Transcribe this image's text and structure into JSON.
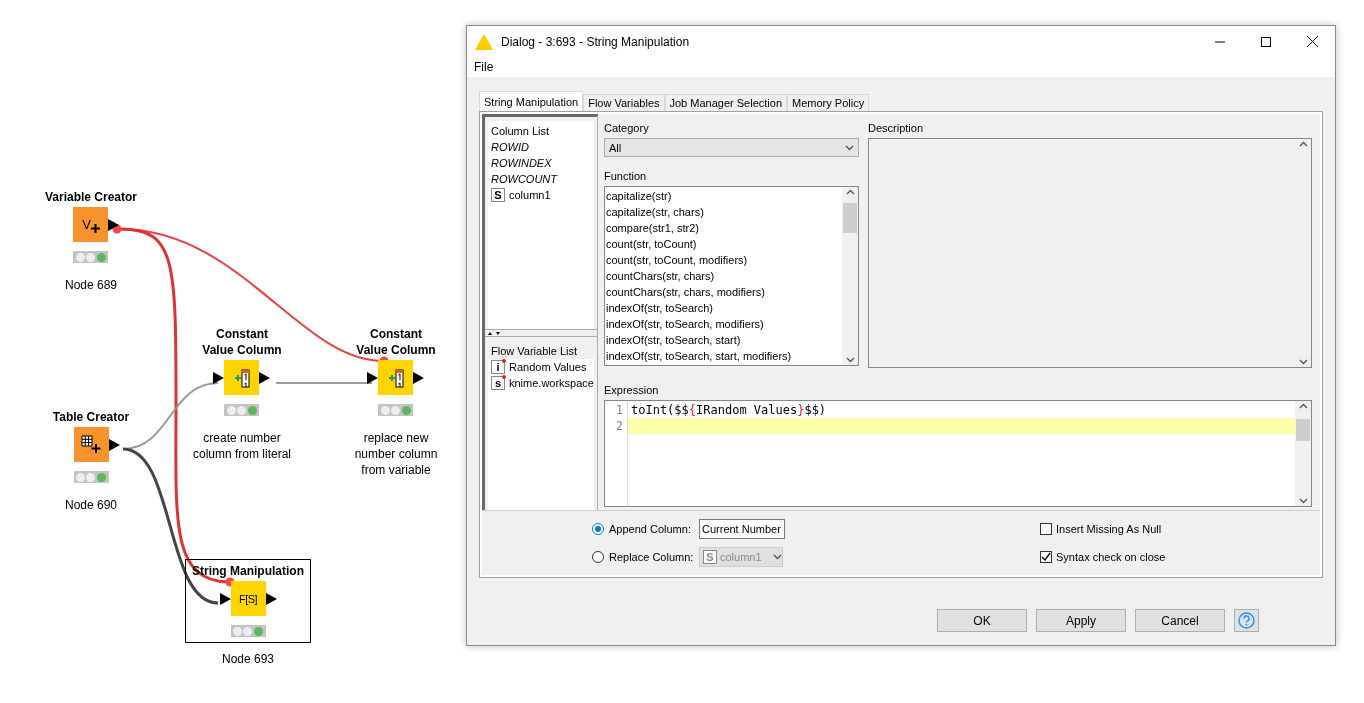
{
  "workflow": {
    "nodes": [
      {
        "kind": "variable-creator",
        "title_lines": [
          "Variable Creator"
        ],
        "icon_text": "V",
        "executed": true,
        "label_lines": [
          "Node 689"
        ],
        "selected": false
      },
      {
        "kind": "table-creator",
        "title_lines": [
          "Table Creator"
        ],
        "executed": true,
        "label_lines": [
          "Node 690"
        ],
        "selected": false
      },
      {
        "kind": "constant-value-column",
        "title_lines": [
          "Constant",
          "Value Column"
        ],
        "executed": true,
        "label_lines": [
          "create number",
          "column from literal"
        ],
        "selected": false
      },
      {
        "kind": "constant-value-column",
        "title_lines": [
          "Constant",
          "Value Column"
        ],
        "executed": true,
        "label_lines": [
          "replace new",
          "number column",
          "from variable"
        ],
        "selected": false
      },
      {
        "kind": "string-manipulation",
        "title_lines": [
          "String Manipulation"
        ],
        "icon_text": "F[S]",
        "executed": true,
        "label_lines": [
          "Node 693"
        ],
        "selected": true
      }
    ]
  },
  "dialog": {
    "title": "Dialog - 3:693 - String Manipulation",
    "menu": [
      "File"
    ],
    "tabs": [
      {
        "label": "String Manipulation",
        "selected": true
      },
      {
        "label": "Flow Variables",
        "selected": false
      },
      {
        "label": "Job Manager Selection",
        "selected": false
      },
      {
        "label": "Memory Policy",
        "selected": false
      }
    ],
    "column_list": {
      "title": "Column List",
      "items": [
        {
          "kind": "special",
          "name": "ROWID"
        },
        {
          "kind": "special",
          "name": "ROWINDEX"
        },
        {
          "kind": "special",
          "name": "ROWCOUNT"
        },
        {
          "kind": "column",
          "badge": "S",
          "name": "column1"
        }
      ]
    },
    "flow_variable_list": {
      "title": "Flow Variable List",
      "items": [
        {
          "badge": "i",
          "name": "Random Values"
        },
        {
          "badge": "s",
          "name": "knime.workspace"
        }
      ]
    },
    "category": {
      "label": "Category",
      "value": "All"
    },
    "function": {
      "label": "Function",
      "items": [
        "capitalize(str)",
        "capitalize(str, chars)",
        "compare(str1, str2)",
        "count(str, toCount)",
        "count(str, toCount, modifiers)",
        "countChars(str, chars)",
        "countChars(str, chars, modifiers)",
        "indexOf(str, toSearch)",
        "indexOf(str, toSearch, modifiers)",
        "indexOf(str, toSearch, start)",
        "indexOf(str, toSearch, start, modifiers)"
      ]
    },
    "description": {
      "label": "Description"
    },
    "expression": {
      "label": "Expression",
      "lines": [
        {
          "number": "1",
          "current": false,
          "tokens": [
            {
              "kind": "plain",
              "text": "toInt($$"
            },
            {
              "kind": "brace",
              "text": "{"
            },
            {
              "kind": "plain",
              "text": "IRandom Values"
            },
            {
              "kind": "brace",
              "text": "}"
            },
            {
              "kind": "plain",
              "text": "$$)"
            }
          ]
        },
        {
          "number": "2",
          "current": true
        }
      ]
    },
    "append": {
      "label": "Append Column:",
      "selected": true,
      "value": "Current Number"
    },
    "replace": {
      "label": "Replace Column:",
      "selected": false,
      "badge": "S",
      "value": "column1",
      "disabled": true
    },
    "options": [
      {
        "label": "Insert Missing As Null",
        "checked": false
      },
      {
        "label": "Syntax check on close",
        "checked": true
      }
    ],
    "buttons": [
      "OK",
      "Apply",
      "Cancel"
    ]
  }
}
